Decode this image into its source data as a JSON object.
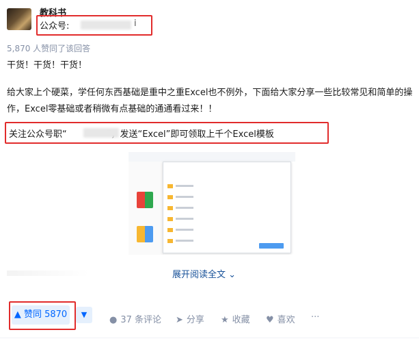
{
  "author": {
    "name": "教科书",
    "gzh_prefix": "公众号:",
    "gzh_suffix": "i"
  },
  "upvote_summary": "5,870 人赞同了该回答",
  "content": {
    "line1": "干货！干货！干货！",
    "paragraph": "给大家上个硬菜，学任何东西基础是重中之重Excel也不例外，下面给大家分享一些比较常见和简单的操作，Excel零基础或者稍微有点基础的通通看过来！！",
    "promo_prefix": "关注公众号职“",
    "promo_suffix": "”，发送“Excel”即可领取上千个Excel模板"
  },
  "expand_label": "展开阅读全文",
  "actions": {
    "vote_label": "▲ 赞同 5870",
    "vote_down": "▼",
    "comments": "37 条评论",
    "share": "分享",
    "collect": "收藏",
    "like": "喜欢",
    "more": "···"
  },
  "colors": {
    "accent": "#0066ff",
    "highlight_box": "#e12b2b",
    "meta": "#8590a6"
  }
}
